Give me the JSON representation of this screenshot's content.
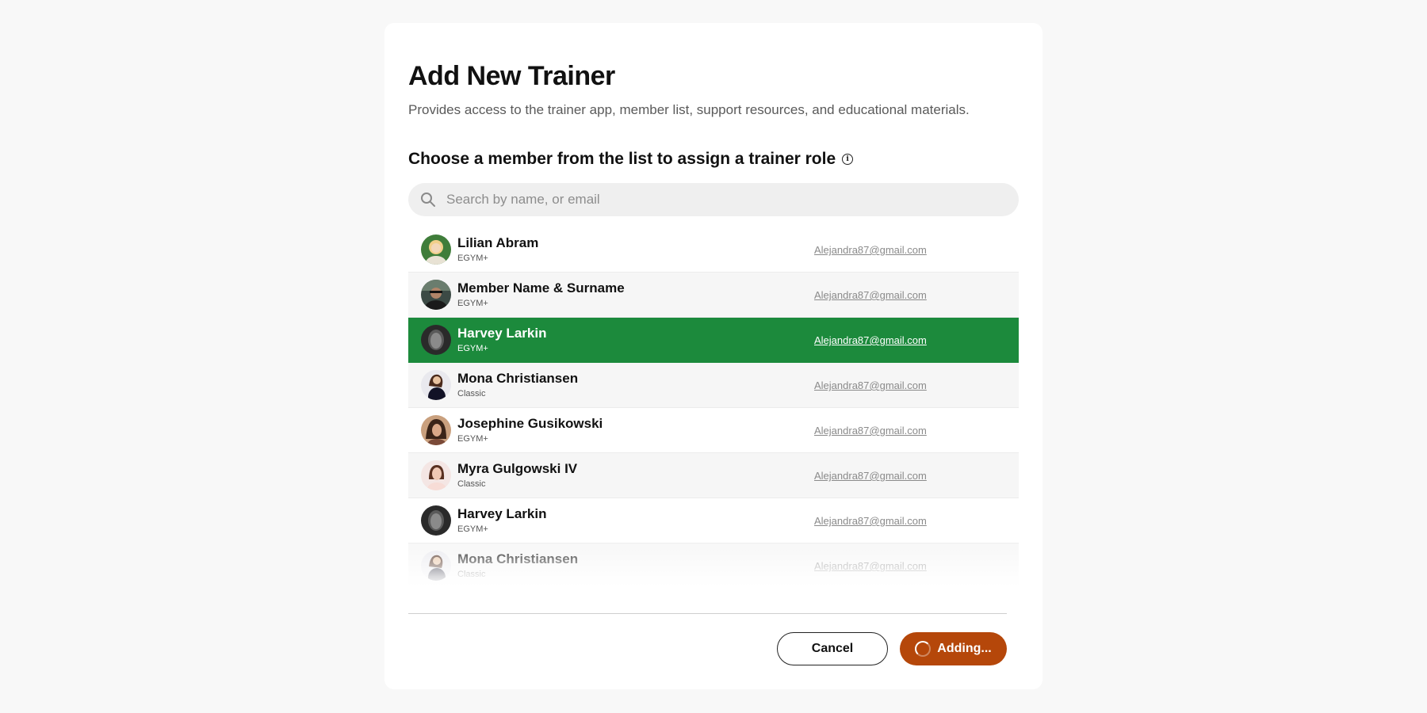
{
  "dialog": {
    "title": "Add New Trainer",
    "subtitle": "Provides access to the trainer app, member list, support resources, and educational materials.",
    "section_heading": "Choose a member from the list to assign a trainer role"
  },
  "search": {
    "placeholder": "Search by name, or email",
    "value": ""
  },
  "members": [
    {
      "name": "Lilian Abram",
      "plan": "EGYM+",
      "email": "Alejandra87@gmail.com",
      "selected": false,
      "avatar_icon": "avatar-photo"
    },
    {
      "name": "Member Name & Surname",
      "plan": "EGYM+",
      "email": "Alejandra87@gmail.com",
      "selected": false,
      "avatar_icon": "avatar-photo"
    },
    {
      "name": "Harvey Larkin",
      "plan": "EGYM+",
      "email": "Alejandra87@gmail.com",
      "selected": true,
      "avatar_icon": "avatar-photo"
    },
    {
      "name": "Mona Christiansen",
      "plan": "Classic",
      "email": "Alejandra87@gmail.com",
      "selected": false,
      "avatar_icon": "avatar-photo"
    },
    {
      "name": "Josephine Gusikowski",
      "plan": "EGYM+",
      "email": "Alejandra87@gmail.com",
      "selected": false,
      "avatar_icon": "avatar-photo"
    },
    {
      "name": "Myra Gulgowski IV",
      "plan": "Classic",
      "email": "Alejandra87@gmail.com",
      "selected": false,
      "avatar_icon": "avatar-photo"
    },
    {
      "name": "Harvey Larkin",
      "plan": "EGYM+",
      "email": "Alejandra87@gmail.com",
      "selected": false,
      "avatar_icon": "avatar-photo"
    },
    {
      "name": "Mona Christiansen",
      "plan": "Classic",
      "email": "Alejandra87@gmail.com",
      "selected": false,
      "avatar_icon": "avatar-photo"
    }
  ],
  "footer": {
    "cancel_label": "Cancel",
    "add_label": "Adding..."
  },
  "colors": {
    "selected_row": "#1c8a3c",
    "primary_button": "#b5470a",
    "background": "#f8f8f8"
  }
}
